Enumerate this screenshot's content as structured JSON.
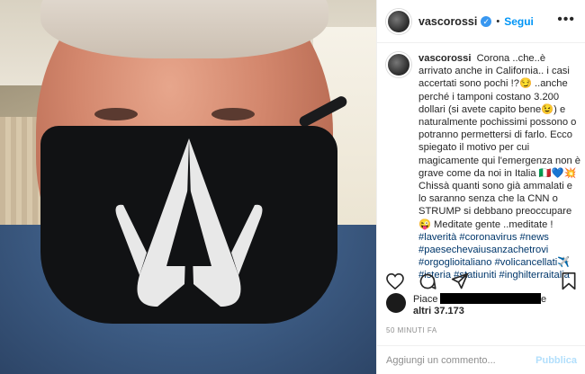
{
  "header": {
    "username": "vascorossi",
    "separator": "•",
    "follow_label": "Segui",
    "more_icon": "more-horizontal-icon"
  },
  "caption": {
    "username": "vascorossi",
    "text": "Corona ..che..è arrivato anche in California.. i casi accertati sono pochi !?😏 ..anche perché i tamponi costano 3.200 dollari (si avete capito bene😉) e naturalmente pochissimi possono o potranno permettersi di farlo. Ecco spiegato il motivo per cui magicamente qui l'emergenza non è grave come da noi in Italia 🇮🇹💙💥 Chissà quanti sono già ammalati e lo saranno senza che la CNN o STRUMP si debbano preoccupare 😜 Meditate gente ..meditate !",
    "hashtags": "#laverità #coronavirus #news #paesechevaiusanzachetrovi #orgoglioitaliano #volicancellati✈️ #isteria #statiuniti #inghilterraitalia"
  },
  "actions": {
    "like": "heart-icon",
    "comment": "comment-icon",
    "share": "paper-plane-icon",
    "save": "bookmark-icon"
  },
  "likes": {
    "prefix": "Piace a",
    "suffix": "e",
    "others": "altri 37.173"
  },
  "time": "50 MINUTI FA",
  "comment_box": {
    "placeholder": "Aggiungi un commento...",
    "publish_label": "Pubblica"
  },
  "colors": {
    "follow": "#0095f6",
    "verified": "#3897f0",
    "hashtag": "#00376b",
    "publish_disabled": "#b2dffc"
  }
}
